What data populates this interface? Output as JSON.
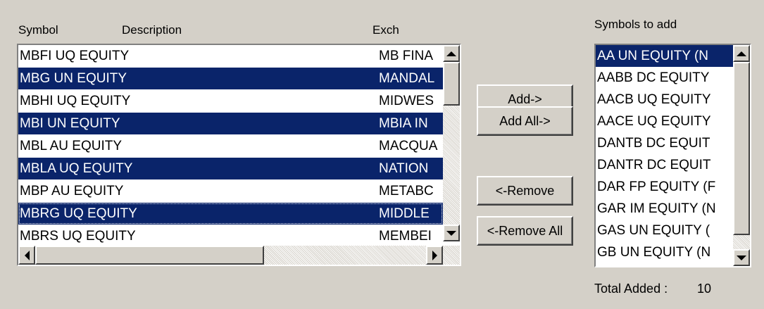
{
  "columns": {
    "symbol": "Symbol",
    "description": "Description",
    "exch": "Exch"
  },
  "left_list": [
    {
      "symbol": "MBFI UQ EQUITY",
      "exch": "MB FINA",
      "selected": false
    },
    {
      "symbol": "MBG UN EQUITY",
      "exch": "MANDAL",
      "selected": true
    },
    {
      "symbol": "MBHI UQ EQUITY",
      "exch": "MIDWES",
      "selected": false
    },
    {
      "symbol": "MBI UN EQUITY",
      "exch": "MBIA IN",
      "selected": true
    },
    {
      "symbol": "MBL AU EQUITY",
      "exch": "MACQUA",
      "selected": false
    },
    {
      "symbol": "MBLA UQ EQUITY",
      "exch": "NATION",
      "selected": true
    },
    {
      "symbol": "MBP AU EQUITY",
      "exch": "METABC",
      "selected": false
    },
    {
      "symbol": "MBRG UQ EQUITY",
      "exch": "MIDDLE",
      "selected": true,
      "focused": true
    },
    {
      "symbol": "MBRS UQ EQUITY",
      "exch": "MEMBEI",
      "selected": false
    }
  ],
  "buttons": {
    "add": "Add->",
    "add_all": "Add All->",
    "remove": "<-Remove",
    "remove_all": "<-Remove All"
  },
  "right_panel": {
    "title": "Symbols to add",
    "items": [
      {
        "text": "AA UN EQUITY (N",
        "selected": true
      },
      {
        "text": "AABB DC EQUITY",
        "selected": false
      },
      {
        "text": "AACB UQ EQUITY",
        "selected": false
      },
      {
        "text": "AACE UQ EQUITY",
        "selected": false
      },
      {
        "text": "DANTB DC EQUIT",
        "selected": false
      },
      {
        "text": "DANTR DC EQUIT",
        "selected": false
      },
      {
        "text": "DAR FP EQUITY (F",
        "selected": false
      },
      {
        "text": "GAR IM EQUITY (N",
        "selected": false
      },
      {
        "text": "GAS UN EQUITY (",
        "selected": false
      },
      {
        "text": "GB UN EQUITY (N",
        "selected": false
      }
    ],
    "total_label": "Total Added :",
    "total_value": "10"
  },
  "colors": {
    "selection": "#0a246a",
    "face": "#d4d0c8"
  }
}
